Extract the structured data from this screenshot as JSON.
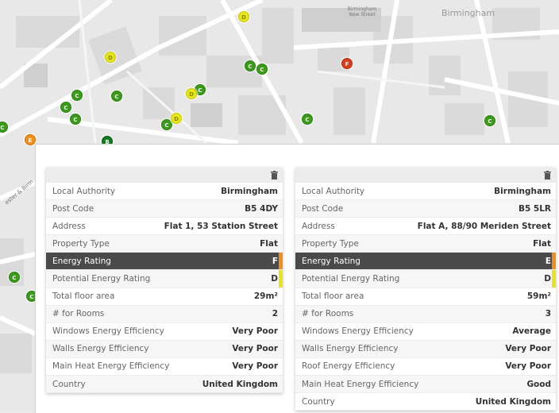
{
  "map": {
    "labels": {
      "city": "Birmingham",
      "station": "Birmingham New Street",
      "road": "ester & Birm"
    },
    "markers": [
      {
        "rating": "D",
        "color": "#e6e61a"
      },
      {
        "rating": "D",
        "color": "#e6e61a"
      },
      {
        "rating": "C",
        "color": "#3a9a19"
      },
      {
        "rating": "C",
        "color": "#3a9a19"
      },
      {
        "rating": "F",
        "color": "#d83c1f"
      },
      {
        "rating": "C",
        "color": "#3a9a19"
      },
      {
        "rating": "C",
        "color": "#3a9a19"
      },
      {
        "rating": "C",
        "color": "#3a9a19"
      },
      {
        "rating": "C",
        "color": "#3a9a19"
      },
      {
        "rating": "D",
        "color": "#e6e61a"
      },
      {
        "rating": "C",
        "color": "#3a9a19"
      },
      {
        "rating": "C",
        "color": "#3a9a19"
      },
      {
        "rating": "D",
        "color": "#e6e61a"
      },
      {
        "rating": "C",
        "color": "#3a9a19"
      },
      {
        "rating": "C",
        "color": "#3a9a19"
      },
      {
        "rating": "E",
        "color": "#f0901a"
      },
      {
        "rating": "B",
        "color": "#0f7a1f"
      },
      {
        "rating": "C",
        "color": "#3a9a19"
      },
      {
        "rating": "C",
        "color": "#3a9a19"
      },
      {
        "rating": "C",
        "color": "#3a9a19"
      }
    ]
  },
  "cards": [
    {
      "rows": [
        {
          "label": "Local Authority",
          "value": "Birmingham"
        },
        {
          "label": "Post Code",
          "value": "B5 4DY"
        },
        {
          "label": "Address",
          "value": "Flat 1, 53 Station Street"
        },
        {
          "label": "Property Type",
          "value": "Flat"
        },
        {
          "label": "Energy Rating",
          "value": "F",
          "highlight": true,
          "bar": "#f0901a"
        },
        {
          "label": "Potential Energy Rating",
          "value": "D",
          "bar": "#e6e61a"
        },
        {
          "label": "Total floor area",
          "value": "29m²"
        },
        {
          "label": "# for Rooms",
          "value": "2"
        },
        {
          "label": "Windows Energy Efficiency",
          "value": "Very Poor"
        },
        {
          "label": "Walls Energy Efficiency",
          "value": "Very Poor"
        },
        {
          "label": "Main Heat Energy Efficiency",
          "value": "Very Poor"
        },
        {
          "label": "Country",
          "value": "United Kingdom"
        }
      ]
    },
    {
      "rows": [
        {
          "label": "Local Authority",
          "value": "Birmingham"
        },
        {
          "label": "Post Code",
          "value": "B5 5LR"
        },
        {
          "label": "Address",
          "value": "Flat A, 88/90 Meriden Street"
        },
        {
          "label": "Property Type",
          "value": "Flat"
        },
        {
          "label": "Energy Rating",
          "value": "E",
          "highlight": true,
          "bar": "#f0901a"
        },
        {
          "label": "Potential Energy Rating",
          "value": "D",
          "bar": "#e6e61a"
        },
        {
          "label": "Total floor area",
          "value": "59m²"
        },
        {
          "label": "# for Rooms",
          "value": "3"
        },
        {
          "label": "Windows Energy Efficiency",
          "value": "Average"
        },
        {
          "label": "Walls Energy Efficiency",
          "value": "Very Poor"
        },
        {
          "label": "Roof Energy Efficiency",
          "value": "Very Poor"
        },
        {
          "label": "Main Heat Energy Efficiency",
          "value": "Good"
        },
        {
          "label": "Country",
          "value": "United Kingdom"
        }
      ]
    }
  ]
}
